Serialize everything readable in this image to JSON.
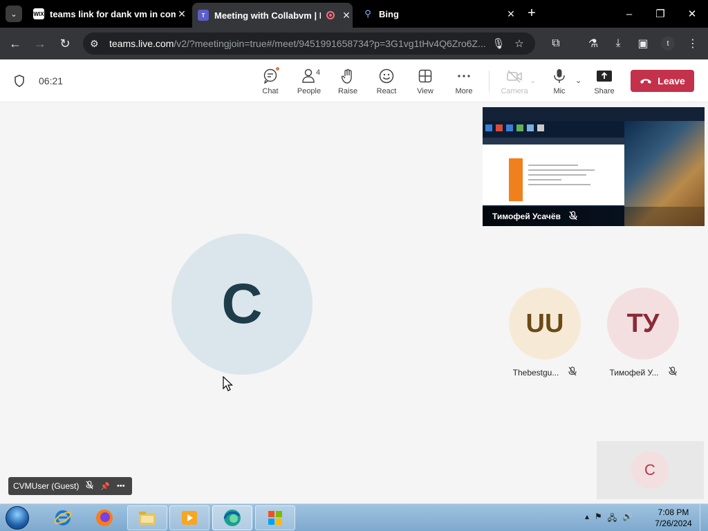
{
  "browser": {
    "tabs": [
      {
        "title": "teams link for dank vm in comments",
        "favicon": "WIX",
        "close": "✕"
      },
      {
        "title": "Meeting with Collabvm | Microsoft Teams",
        "favicon": "T",
        "close": "✕"
      },
      {
        "title": "Bing",
        "favicon": "⚲",
        "close": "✕"
      }
    ],
    "url_host": "teams.live.com",
    "url_path": "/v2/?meetingjoin=true#/meet/9451991658734?p=3G1vg1tHv4Q6Zro6Z...",
    "profile_initial": "t"
  },
  "teams": {
    "timer": "06:21",
    "buttons": {
      "chat": "Chat",
      "people": "People",
      "people_count": "4",
      "raise": "Raise",
      "react": "React",
      "view": "View",
      "more": "More",
      "camera": "Camera",
      "mic": "Mic",
      "share": "Share"
    },
    "leave": "Leave"
  },
  "stage": {
    "main_avatar": "C",
    "shared_screen_presenter": "Тимофей Усачёв",
    "participants": [
      {
        "initials": "UU",
        "name": "Thebestgu...",
        "bg": "#f6ead7",
        "fg": "#6b4a16"
      },
      {
        "initials": "ТУ",
        "name": "Тимофей У...",
        "bg": "#f4dfe0",
        "fg": "#8a2b36"
      }
    ],
    "self_avatar": "C",
    "self_name": "CVMUser (Guest)"
  },
  "taskbar": {
    "time": "7:08 PM",
    "date": "7/26/2024"
  }
}
